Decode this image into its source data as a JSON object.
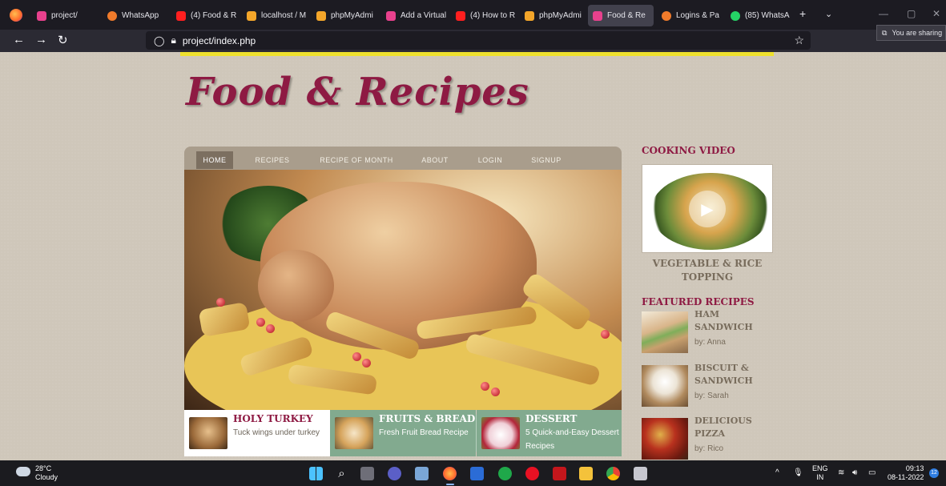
{
  "browser": {
    "tabs": [
      {
        "label": "project/",
        "color": "#e8418d"
      },
      {
        "label": "WhatsApp",
        "color": "#f07b2b"
      },
      {
        "label": "(4) Food & R",
        "color": "#ff1f1f"
      },
      {
        "label": "localhost / M",
        "color": "#f4a62a"
      },
      {
        "label": "phpMyAdmi",
        "color": "#f4a62a"
      },
      {
        "label": "Add a Virtual",
        "color": "#e8418d"
      },
      {
        "label": "(4) How to R",
        "color": "#ff1f1f"
      },
      {
        "label": "phpMyAdmi",
        "color": "#f4a62a"
      },
      {
        "label": "Food & Re",
        "color": "#e8418d"
      },
      {
        "label": "Logins & Pa",
        "color": "#f07b2b"
      },
      {
        "label": "(85) WhatsA",
        "color": "#25d366"
      }
    ],
    "url": "project/index.php",
    "share_notice": "You are sharing"
  },
  "site": {
    "logo": "Food & Recipes",
    "menu": [
      "HOME",
      "RECIPES",
      "RECIPE OF MONTH",
      "ABOUT",
      "LOGIN",
      "SIGNUP"
    ],
    "cards": [
      {
        "title": "HOLY TURKEY",
        "sub": "Tuck wings under turkey"
      },
      {
        "title": "FRUITS & BREAD",
        "sub": "Fresh Fruit Bread Recipe"
      },
      {
        "title": "DESSERT",
        "sub": "5 Quick-and-Easy Dessert Recipes"
      }
    ],
    "sidebar": {
      "video_heading": "COOKING VIDEO",
      "video_caption": "VEGETABLE & RICE TOPPING",
      "featured_heading": "FEATURED RECIPES",
      "featured": [
        {
          "name": "HAM SANDWICH",
          "by": "by: Anna"
        },
        {
          "name": "BISCUIT & SANDWICH",
          "by": "by: Sarah"
        },
        {
          "name": "DELICIOUS PIZZA",
          "by": "by: Rico"
        }
      ]
    }
  },
  "taskbar": {
    "temp": "28°C",
    "condition": "Cloudy",
    "lang": "ENG",
    "region": "IN",
    "time": "09:13",
    "date": "08-11-2022",
    "notifications": "12"
  },
  "icons": {
    "back": "arrow-left-icon",
    "forward": "arrow-right-icon",
    "reload": "reload-icon",
    "bookmark": "star-icon",
    "play": "play-icon"
  }
}
